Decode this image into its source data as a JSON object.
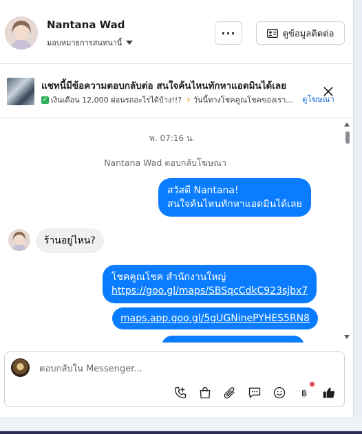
{
  "header": {
    "name": "Nantana Wad",
    "assign_label": "มอบหมายการสนทนานี้",
    "more_label": "···",
    "contact_button": "ดูข้อมูลติดต่อ"
  },
  "ad": {
    "title": "แชทนี้มีข้อความตอบกลับต่อ สนใจค้นไหนทักหาแอดมินได้เลย",
    "subtitle_part1": "เงินเดือน 12,000 ผ่อนรถอะไรได้บ้าง!!?",
    "subtitle_part2": "วันนี้ทางโชคคูณโชคของเรา...",
    "link": "ดูโฆษณา"
  },
  "chat": {
    "timestamp": "พ. 07:16 น.",
    "reply_note": "Nantana Wad ตอบกลับโฆษณา",
    "messages": [
      {
        "dir": "out",
        "line1": "สวัสดี Nantana!",
        "line2": "สนใจค้นไหนทักหาแอดมินได้เลย"
      },
      {
        "dir": "in",
        "text": "ร้านอยู่ไหน?"
      },
      {
        "dir": "out",
        "line1": "โชคคูณโชค สำนักงานใหญ่",
        "link": "https://goo.gl/maps/SBSqcCdkC923sjbx7"
      },
      {
        "dir": "out",
        "link": "maps.app.goo.gl/5gUGNinePYHES5RN8"
      }
    ]
  },
  "composer": {
    "placeholder": "ตอบกลับใน Messenger..."
  },
  "colors": {
    "outgoing_bubble": "#0a7cff",
    "incoming_bubble": "#f0f0f0",
    "link": "#216fdb",
    "like": "#1c1e21"
  }
}
